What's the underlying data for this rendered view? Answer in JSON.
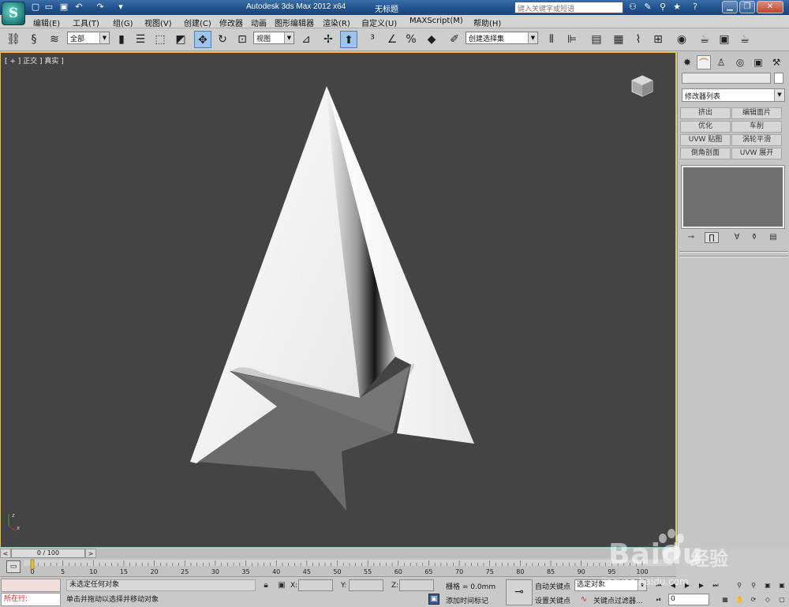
{
  "titlebar": {
    "app_title": "Autodesk 3ds Max  2012 x64",
    "doc_title": "无标题",
    "search_placeholder": "键入关键字或短语",
    "quick_access_icons": [
      "new-icon",
      "open-icon",
      "save-icon",
      "undo-icon",
      "redo-icon",
      "customize-dropdown-icon"
    ],
    "right_icons": [
      "binoculars-icon",
      "tools-icon",
      "search-communication-icon",
      "favorites-star-icon",
      "help-icon"
    ]
  },
  "menu": {
    "items": [
      "编辑(E)",
      "工具(T)",
      "组(G)",
      "视图(V)",
      "创建(C)",
      "修改器",
      "动画",
      "图形编辑器",
      "渲染(R)",
      "自定义(U)",
      "MAXScript(M)",
      "帮助(H)"
    ]
  },
  "toolbar": {
    "selection_filter": "全部",
    "ref_coord": "视图",
    "named_selection": "创建选择集",
    "icons": [
      "link-icon",
      "unlink-icon",
      "bind-spacewarp-icon",
      "select-object-icon",
      "select-by-name-icon",
      "rect-region-icon",
      "window-crossing-icon",
      "move-icon",
      "rotate-icon",
      "scale-icon",
      "pivot-icon",
      "select-manipulate-icon",
      "keyboard-shortcut-icon",
      "snap-3d-icon",
      "angle-snap-icon",
      "percent-snap-icon",
      "spinner-snap-icon",
      "edit-named-selection-icon",
      "mirror-icon",
      "align-icon",
      "layer-manager-icon",
      "graphite-ribbon-icon",
      "curve-editor-icon",
      "schematic-view-icon",
      "material-editor-icon",
      "render-setup-icon",
      "rendered-frame-icon",
      "render-icon"
    ]
  },
  "viewport": {
    "label": "[ + ] 正交 ] 真实 ]",
    "background": "#444444",
    "border_color": "#e4c13c"
  },
  "command_panel": {
    "tabs": [
      "create-tab-icon",
      "modify-tab-icon",
      "hierarchy-tab-icon",
      "motion-tab-icon",
      "display-tab-icon",
      "utilities-tab-icon"
    ],
    "modifier_list": "修改器列表",
    "modifier_buttons": [
      "挤出",
      "编辑面片",
      "优化",
      "车削",
      "UVW 贴图",
      "涡轮平滑",
      "倒角剖面",
      "UVW 展开"
    ],
    "stack_icons": [
      "pin-stack-icon",
      "show-end-result-icon",
      "make-unique-icon",
      "remove-modifier-icon",
      "configure-sets-icon"
    ]
  },
  "timeline": {
    "slider_label": "0 / 100",
    "ticks": [
      "0",
      "5",
      "10",
      "15",
      "20",
      "25",
      "30",
      "35",
      "40",
      "45",
      "50",
      "55",
      "60",
      "65",
      "70",
      "75",
      "80",
      "85",
      "90",
      "95",
      "100"
    ]
  },
  "status": {
    "script_status": "所在行:",
    "selection_msg": "未选定任何对象",
    "prompt": "单击并拖动以选择并移动对象",
    "x_label": "X:",
    "y_label": "Y:",
    "z_label": "Z:",
    "grid": "栅格 = 0.0mm",
    "add_time_tag": "添加时间标记",
    "auto_key": "自动关键点",
    "set_key": "设置关键点",
    "selected_objects": "选定对象",
    "key_filters": "关键点过滤器...",
    "frame": "0"
  },
  "watermark": {
    "brand": "Baidu",
    "product": "经验",
    "url": "jingyan.baidu.com"
  }
}
